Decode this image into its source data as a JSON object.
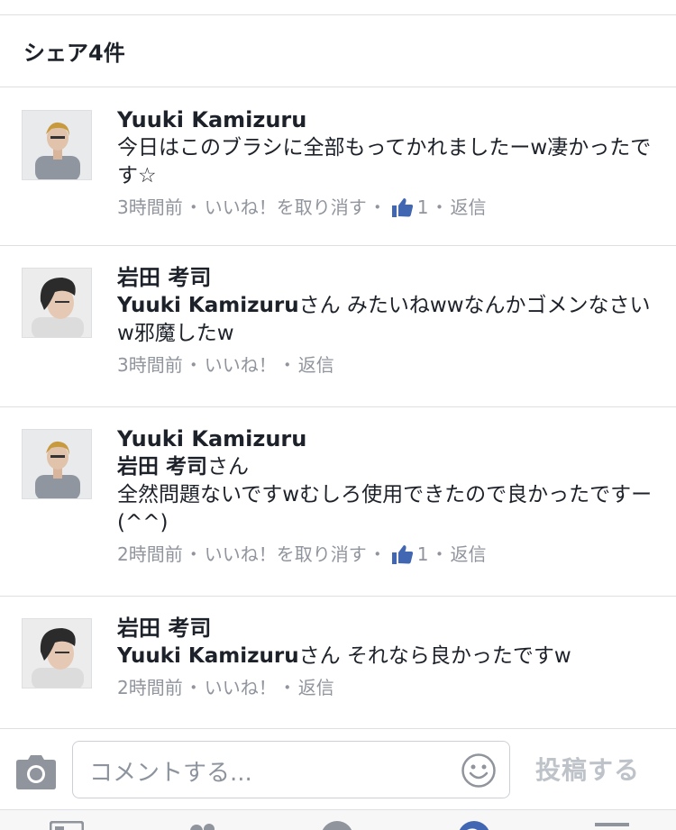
{
  "header": {
    "shares_label": "シェア4件"
  },
  "comments": [
    {
      "author": "Yuuki Kamizuru",
      "mention": "",
      "text": "今日はこのブラシに全部もってかれましたーw凄かったです☆",
      "time": "3時間前",
      "like_label": "いいね！を取り消す",
      "like_count": "1",
      "reply_label": "返信"
    },
    {
      "author": "岩田 考司",
      "mention": "Yuuki Kamizuru",
      "mention_suffix": "さん",
      "text": "みたいねwwなんかゴメンなさいw邪魔したw",
      "time": "3時間前",
      "like_label": "いいね！",
      "reply_label": "返信"
    },
    {
      "author": "Yuuki Kamizuru",
      "mention": "岩田 考司",
      "mention_suffix": "さん",
      "text": "全然問題ないですwむしろ使用できたので良かったですー(^^)",
      "time": "2時間前",
      "like_label": "いいね！を取り消す",
      "like_count": "1",
      "reply_label": "返信"
    },
    {
      "author": "岩田 考司",
      "mention": "Yuuki Kamizuru",
      "mention_suffix": "さん",
      "text": "それなら良かったですw",
      "time": "2時間前",
      "like_label": "いいね！",
      "reply_label": "返信"
    }
  ],
  "composer": {
    "placeholder": "コメントする...",
    "post_label": "投稿する",
    "camera_icon": "camera-icon",
    "emoji_icon": "smiley-icon"
  },
  "colors": {
    "like_blue": "#4267b2",
    "meta_gray": "#90949c",
    "divider": "#dddfe2"
  }
}
